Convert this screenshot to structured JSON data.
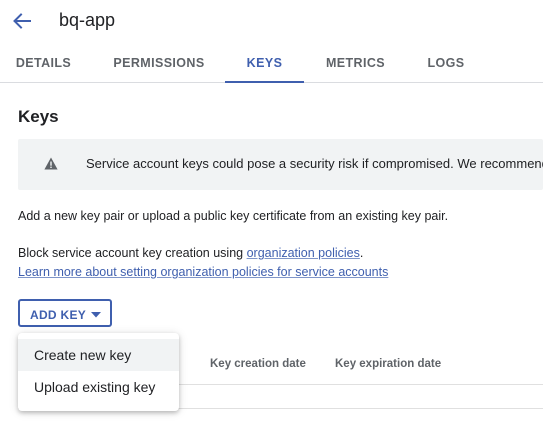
{
  "header": {
    "title": "bq-app",
    "back_icon": "arrow-left-icon"
  },
  "tabs": [
    {
      "label": "DETAILS",
      "active": false
    },
    {
      "label": "PERMISSIONS",
      "active": false
    },
    {
      "label": "KEYS",
      "active": true
    },
    {
      "label": "METRICS",
      "active": false
    },
    {
      "label": "LOGS",
      "active": false
    }
  ],
  "keys_section": {
    "title": "Keys",
    "warning": {
      "icon": "warning-triangle-icon",
      "text": "Service account keys could pose a security risk if compromised. We recommend"
    },
    "description": "Add a new key pair or upload a public key certificate from an existing key pair.",
    "block_text": "Block service account key creation using ",
    "block_link": "organization policies",
    "block_text_end": ".",
    "learn_more_link": "Learn more about setting organization policies for service accounts"
  },
  "add_key_button": {
    "label": "ADD KEY",
    "icon": "caret-down-icon"
  },
  "dropdown_menu": {
    "items": [
      "Create new key",
      "Upload existing key"
    ],
    "highlighted_index": 0
  },
  "keys_table": {
    "columns": [
      "Key creation date",
      "Key expiration date"
    ],
    "rows": []
  },
  "colors": {
    "accent": "#3f5fae",
    "text_primary": "#202124",
    "text_secondary": "#5f6368",
    "warning_bg": "#f1f3f4",
    "divider": "#dadce0"
  }
}
